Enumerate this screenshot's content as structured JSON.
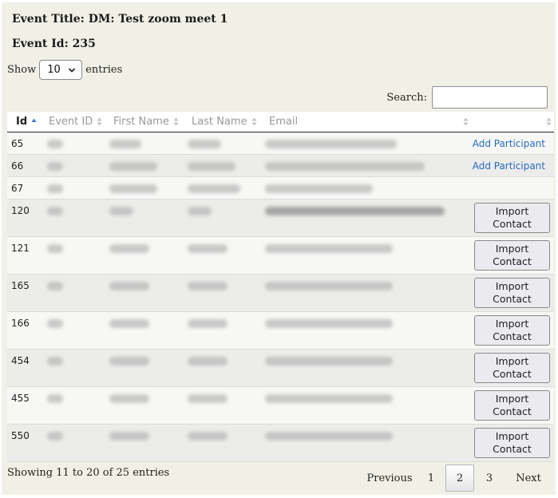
{
  "header": {
    "event_title": "Event Title: DM: Test zoom meet 1",
    "event_id": "Event Id: 235"
  },
  "length": {
    "show_label": "Show",
    "selected": "10",
    "entries_label": "entries"
  },
  "search": {
    "label": "Search:",
    "value": ""
  },
  "columns": [
    "Id",
    "Event ID",
    "First Name",
    "Last Name",
    "Email",
    ""
  ],
  "rows": [
    {
      "id": "65",
      "action": "Add Participant"
    },
    {
      "id": "66",
      "action": "Add Participant"
    },
    {
      "id": "67",
      "action": ""
    },
    {
      "id": "120",
      "action": "Import Contact",
      "action_line1": "Import",
      "action_line2": "Contact"
    },
    {
      "id": "121",
      "action": "Import Contact",
      "action_line1": "Import",
      "action_line2": "Contact"
    },
    {
      "id": "165",
      "action": "Import Contact",
      "action_line1": "Import",
      "action_line2": "Contact"
    },
    {
      "id": "166",
      "action": "Import Contact",
      "action_line1": "Import",
      "action_line2": "Contact"
    },
    {
      "id": "454",
      "action": "Import Contact",
      "action_line1": "Import",
      "action_line2": "Contact"
    },
    {
      "id": "455",
      "action": "Import Contact",
      "action_line1": "Import",
      "action_line2": "Contact"
    },
    {
      "id": "550",
      "action": "Import Contact",
      "action_line1": "Import",
      "action_line2": "Contact"
    }
  ],
  "footer": {
    "info": "Showing 11 to 20 of 25 entries",
    "previous": "Previous",
    "pages": [
      "1",
      "2",
      "3"
    ],
    "current_page": "2",
    "next": "Next"
  },
  "colors": {
    "panel_bg": "#f1f0e6",
    "link": "#2a6bbf",
    "sort_active": "#3a7bd5"
  },
  "icons": {
    "length_select": "chevron-down-icon",
    "sort_active": "sort-asc-icon",
    "sort_inactive": "sort-both-icon"
  }
}
